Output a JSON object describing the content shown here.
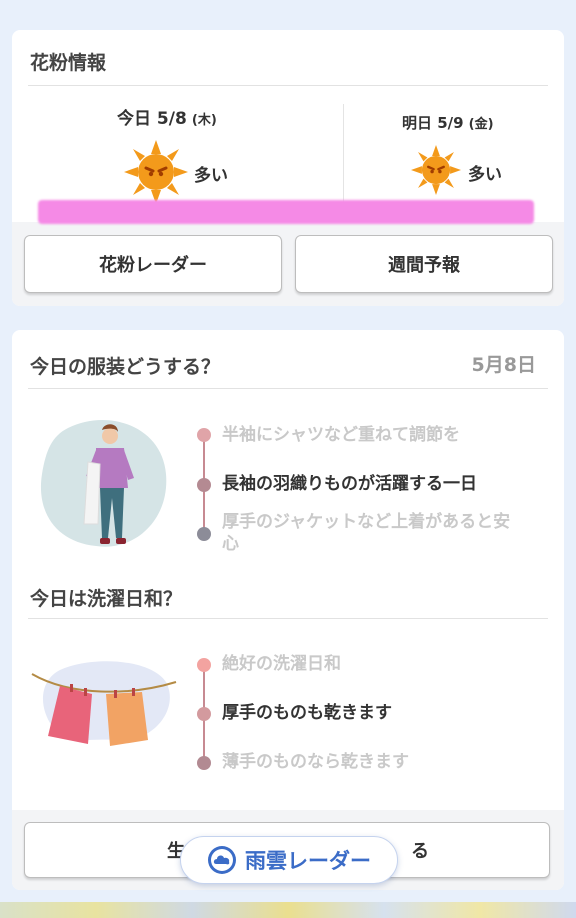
{
  "pollen": {
    "title": "花粉情報",
    "today": {
      "label": "今日 5/8",
      "weekday": "(木)",
      "level": "多い"
    },
    "tomorrow": {
      "label": "明日 5/9",
      "weekday": "(金)",
      "level": "多い"
    },
    "radar_button": "花粉レーダー",
    "weekly_button": "週間予報"
  },
  "clothes": {
    "title": "今日の服装どうする？",
    "date": "5月8日",
    "levels": [
      "半袖にシャツなど重ねて調節を",
      "長袖の羽織りものが活躍する一日",
      "厚手のジャケットなど上着があると安",
      "心"
    ],
    "active_index": 1
  },
  "laundry": {
    "title": "今日は洗濯日和？",
    "levels": [
      "絶好の洗濯日和",
      "厚手のものも乾きます",
      "薄手のものなら乾きます"
    ],
    "active_index": 1
  },
  "bottom": {
    "button_left": "生",
    "button_right": "る"
  },
  "rain_radar": {
    "label": "雨雲レーダー"
  },
  "colors": {
    "accent": "#3b6cc7",
    "pollen_sun": "#f39a1b",
    "pink_band": "#f58ae6"
  }
}
